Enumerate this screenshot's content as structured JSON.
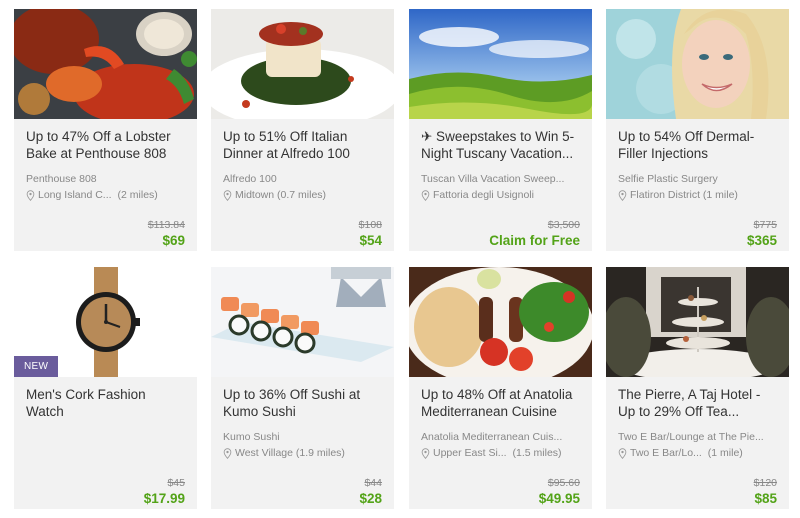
{
  "colors": {
    "card_bg": "#f2f2f2",
    "price_green": "#53a318",
    "badge_purple": "#6a5c9c",
    "text": "#333333",
    "muted": "#888888"
  },
  "deals": [
    {
      "title": "Up to 47% Off a Lobster Bake at Penthouse 808",
      "merchant": "Penthouse 808",
      "location": "Long Island C...",
      "distance": "(2 miles)",
      "original_price": "$113.84",
      "price": "$69",
      "image": "lobster-bake-photo"
    },
    {
      "title": "Up to 51% Off Italian Dinner at Alfredo 100",
      "merchant": "Alfredo 100",
      "location": "Midtown (0.7 miles)",
      "distance": "",
      "original_price": "$108",
      "price": "$54",
      "image": "italian-fish-dish-photo"
    },
    {
      "title": "✈ Sweepstakes to Win 5-Night Tuscany Vacation...",
      "merchant": "Tuscan Villa Vacation Sweep...",
      "location": "Fattoria degli Usignoli",
      "distance": "",
      "original_price": "$3,500",
      "price": "Claim for Free",
      "image": "tuscany-landscape-photo"
    },
    {
      "title": "Up to 54% Off Dermal-Filler Injections",
      "merchant": "Selfie Plastic Surgery",
      "location": "Flatiron District (1 mile)",
      "distance": "",
      "original_price": "$775",
      "price": "$365",
      "image": "smiling-woman-photo"
    },
    {
      "title": "Men's Cork Fashion Watch",
      "badge": "NEW",
      "merchant": "",
      "location": "",
      "distance": "",
      "original_price": "$45",
      "price": "$17.99",
      "image": "cork-watch-photo"
    },
    {
      "title": "Up to 36% Off Sushi at Kumo Sushi",
      "merchant": "Kumo Sushi",
      "location": "West Village (1.9 miles)",
      "distance": "",
      "original_price": "$44",
      "price": "$28",
      "image": "sushi-platter-photo"
    },
    {
      "title": "Up to 48% Off at Anatolia Mediterranean Cuisine",
      "merchant": "Anatolia Mediterranean Cuis...",
      "location": "Upper East Si...",
      "distance": "(1.5 miles)",
      "original_price": "$95.60",
      "price": "$49.95",
      "image": "mediterranean-plate-photo"
    },
    {
      "title": "The Pierre, A Taj Hotel - Up to 29% Off Tea...",
      "merchant": "Two E Bar/Lounge at The Pie...",
      "location": "Two E Bar/Lo...",
      "distance": "(1 mile)",
      "original_price": "$120",
      "price": "$85",
      "image": "afternoon-tea-photo"
    }
  ]
}
